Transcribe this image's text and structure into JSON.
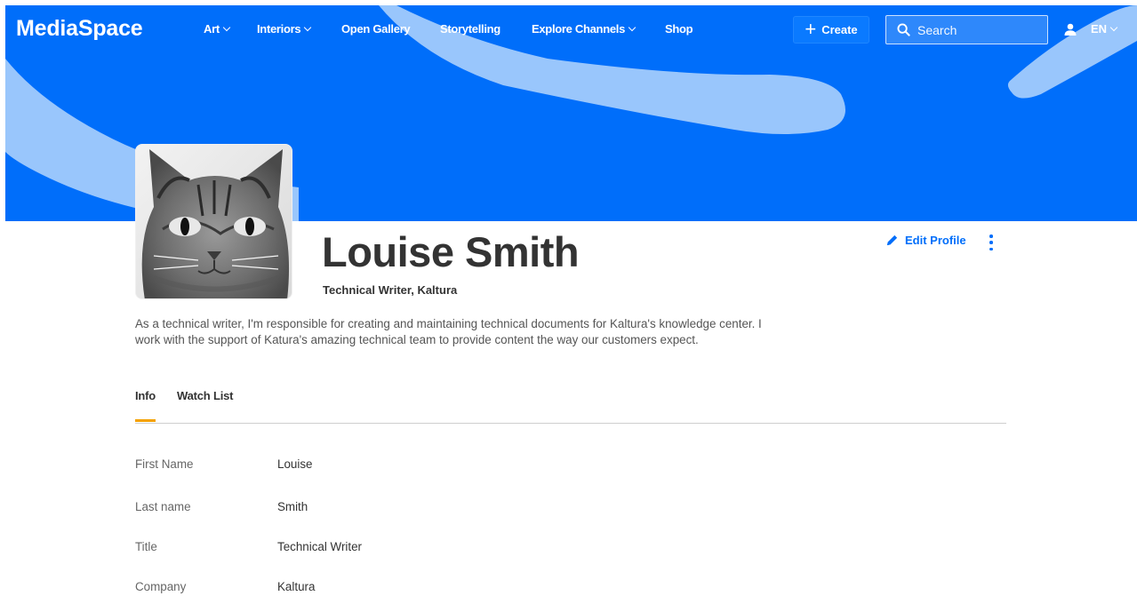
{
  "app": {
    "logo": "MediaSpace"
  },
  "nav": {
    "items": [
      {
        "label": "Art",
        "dropdown": true
      },
      {
        "label": "Interiors",
        "dropdown": true
      },
      {
        "label": "Open Gallery",
        "dropdown": false
      },
      {
        "label": "Storytelling",
        "dropdown": false
      },
      {
        "label": "Explore Channels",
        "dropdown": true
      },
      {
        "label": "Shop",
        "dropdown": false
      }
    ],
    "create_label": "Create",
    "search_placeholder": "Search",
    "language": "EN"
  },
  "profile": {
    "name": "Louise Smith",
    "subtitle": "Technical Writer, Kaltura",
    "edit_label": "Edit Profile",
    "bio": "As a technical writer, I'm responsible for creating and maintaining technical documents for Kaltura's knowledge center. I work with the support of Katura's amazing technical team to provide content the way our customers expect.",
    "avatar_icon": "cat-photo"
  },
  "tabs": [
    {
      "label": "Info",
      "active": true
    },
    {
      "label": "Watch List",
      "active": false
    }
  ],
  "info": [
    {
      "label": "First Name",
      "value": "Louise"
    },
    {
      "label": "Last name",
      "value": "Smith"
    },
    {
      "label": "Title",
      "value": "Technical Writer"
    },
    {
      "label": "Company",
      "value": "Kaltura"
    }
  ],
  "colors": {
    "brand_blue": "#006efa",
    "tab_accent": "#f4a100",
    "hero_swoosh": "#99c6fc"
  }
}
